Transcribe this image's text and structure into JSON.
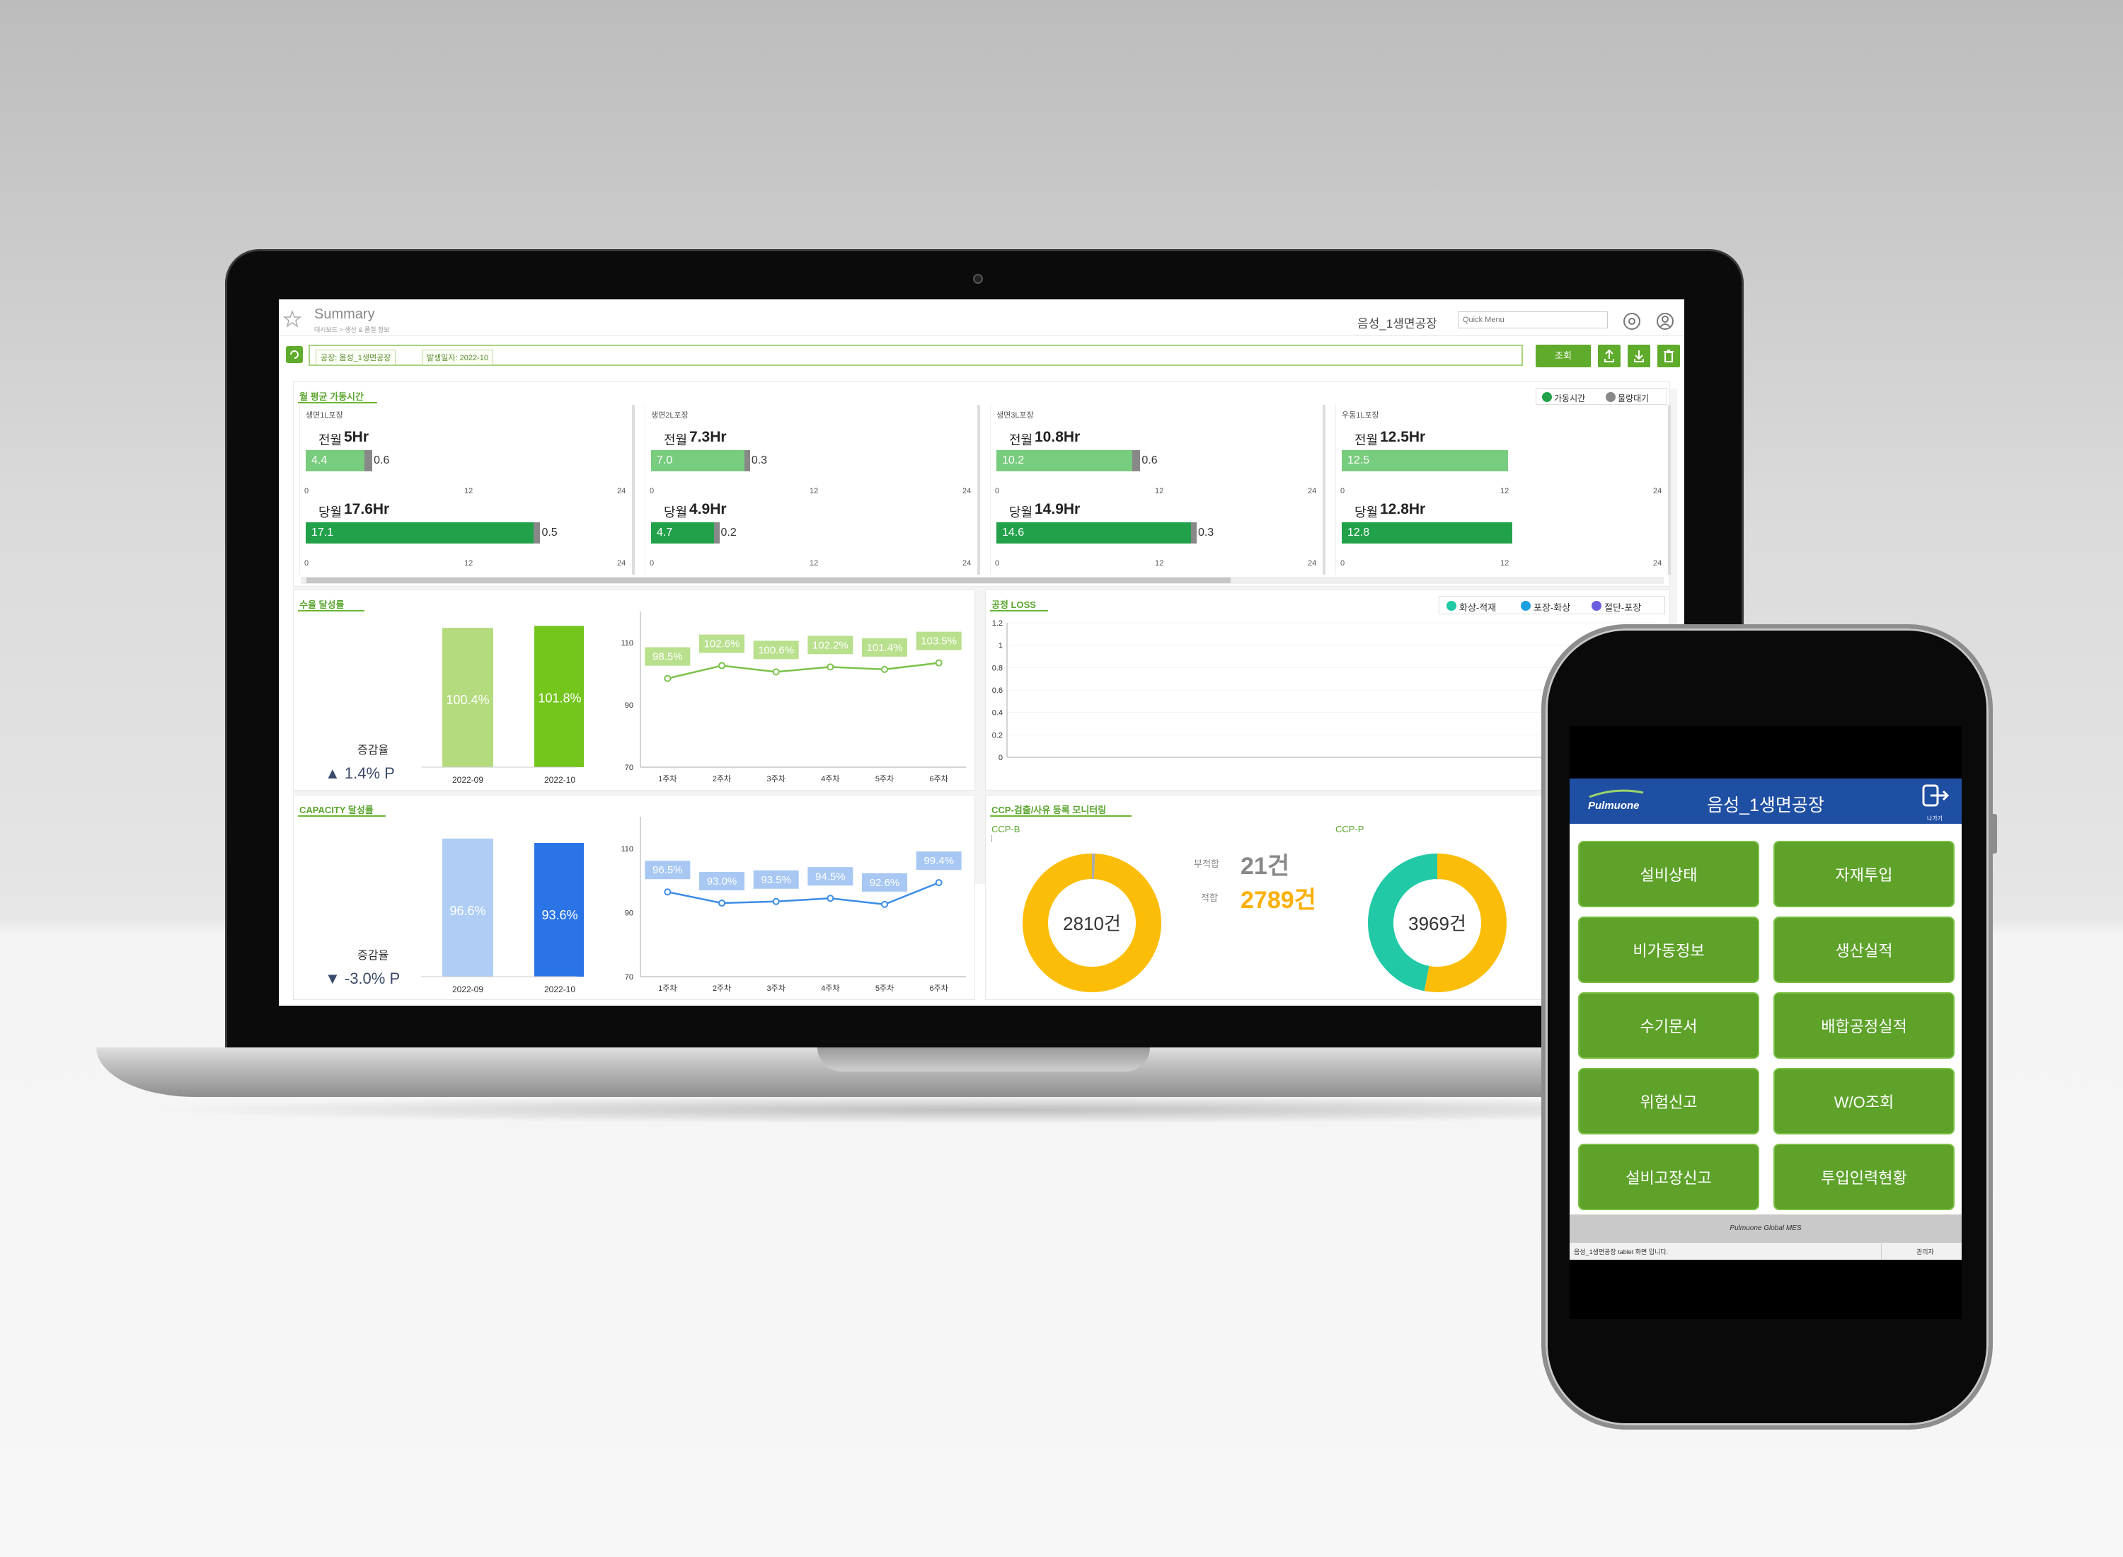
{
  "dashboard": {
    "title": "Summary",
    "breadcrumb": "대시보드 > 생산 & 품질 정보",
    "factory_name": "음성_1생면공장",
    "quick_menu_placeholder": "Quick Menu",
    "filters": {
      "factory_tag": "공장: 음성_1생면공장",
      "date_tag": "발생일자: 2022-10",
      "search_button": "조회"
    },
    "uptime": {
      "title": "월 평균 가동시간",
      "legend": [
        "가동시간",
        "물량대기"
      ],
      "axis": [
        "0",
        "12",
        "24"
      ],
      "prev_label": "전월",
      "curr_label": "당월",
      "lines": [
        {
          "name": "생면1L포장",
          "prev_total": "5Hr",
          "prev_run": 4.4,
          "prev_wait": 0.6,
          "curr_total": "17.6Hr",
          "curr_run": 17.1,
          "curr_wait": 0.5
        },
        {
          "name": "생면2L포장",
          "prev_total": "7.3Hr",
          "prev_run": 7.0,
          "prev_wait": 0.3,
          "curr_total": "4.9Hr",
          "curr_run": 4.7,
          "curr_wait": 0.2
        },
        {
          "name": "생면3L포장",
          "prev_total": "10.8Hr",
          "prev_run": 10.2,
          "prev_wait": 0.6,
          "curr_total": "14.9Hr",
          "curr_run": 14.6,
          "curr_wait": 0.3
        },
        {
          "name": "우동1L포장",
          "prev_total": "12.5Hr",
          "prev_run": 12.5,
          "prev_wait": null,
          "curr_total": "12.8Hr",
          "curr_run": 12.8,
          "curr_wait": null
        }
      ],
      "labels_text": {
        "l1": {
          "pr": "4.4",
          "pw": "0.6",
          "cr": "17.1",
          "cw": "0.5"
        },
        "l2": {
          "pr": "7.0",
          "pw": "0.3",
          "cr": "4.7",
          "cw": "0.2"
        },
        "l3": {
          "pr": "10.2",
          "pw": "0.6",
          "cr": "14.6",
          "cw": "0.3"
        },
        "l4": {
          "pr": "12.5",
          "cr": "12.8"
        }
      }
    },
    "yield_panel": {
      "title": "수율 달성률",
      "change_label": "증감율",
      "change_value": "▲ 1.4% P"
    },
    "capacity_panel": {
      "title": "CAPACITY 달성률",
      "change_label": "증감율",
      "change_value": "▼ -3.0% P"
    },
    "loss_panel": {
      "title": "공정 LOSS",
      "legend": [
        "화상-적재",
        "포장-화상",
        "절단-포장"
      ]
    },
    "ccp_panel": {
      "title": "CCP-검출/사유 등록 모니터링",
      "ccp_b": "CCP-B",
      "ccp_p": "CCP-P",
      "unfit_label": "부적합",
      "unfit_value": "21건",
      "fit_label": "적합",
      "fit_value": "2789건",
      "donut1_center": "2810건",
      "donut2_center": "3969건"
    }
  },
  "chart_data": [
    {
      "type": "bar",
      "title": "수율 달성률",
      "categories": [
        "2022-09",
        "2022-10"
      ],
      "values": [
        100.4,
        101.8
      ],
      "value_labels": [
        "100.4%",
        "101.8%"
      ],
      "colors": [
        "#b5db7f",
        "#74c51c"
      ]
    },
    {
      "type": "line",
      "title": "수율 달성률",
      "x": [
        "1주차",
        "2주차",
        "3주차",
        "4주차",
        "5주차",
        "6주차"
      ],
      "values": [
        98.5,
        102.6,
        100.6,
        102.2,
        101.4,
        103.5
      ],
      "value_labels": [
        "98.5%",
        "102.6%",
        "100.6%",
        "102.2%",
        "101.4%",
        "103.5%"
      ],
      "yticks": [
        "110",
        "90",
        "70"
      ],
      "ylim": [
        70,
        120
      ]
    },
    {
      "type": "bar",
      "title": "CAPACITY 달성률",
      "categories": [
        "2022-09",
        "2022-10"
      ],
      "values": [
        96.6,
        93.6
      ],
      "value_labels": [
        "96.6%",
        "93.6%"
      ],
      "colors": [
        "#afcdf5",
        "#2a74e8"
      ]
    },
    {
      "type": "line",
      "title": "CAPACITY 달성률",
      "x": [
        "1주차",
        "2주차",
        "3주차",
        "4주차",
        "5주차",
        "6주차"
      ],
      "values": [
        96.5,
        93.0,
        93.5,
        94.5,
        92.6,
        99.4
      ],
      "value_labels": [
        "96.5%",
        "93.0%",
        "93.5%",
        "94.5%",
        "92.6%",
        "99.4%"
      ],
      "yticks": [
        "110",
        "90",
        "70"
      ],
      "ylim": [
        70,
        120
      ]
    },
    {
      "type": "line",
      "title": "공정 LOSS",
      "yticks": [
        "1.2",
        "1",
        "0.8",
        "0.6",
        "0.4",
        "0.2",
        "0"
      ],
      "ylim": [
        0,
        1.2
      ],
      "series": []
    },
    {
      "type": "pie",
      "title": "CCP-B",
      "values": [
        21,
        2789
      ],
      "colors": [
        "#aaaaaa",
        "#fbbd07"
      ]
    },
    {
      "type": "pie",
      "title": "CCP-P",
      "values": [
        53,
        47
      ],
      "colors": [
        "#fbbd07",
        "#21c9a6"
      ]
    }
  ],
  "phone": {
    "brand": "Pulmuone",
    "factory_name": "음성_1생면공장",
    "logout_label": "나가기",
    "menu": [
      "설비상태",
      "자재투입",
      "비가동정보",
      "생산실적",
      "수기문서",
      "배합공정실적",
      "위험신고",
      "W/O조회",
      "설비고장신고",
      "투입인력현황"
    ],
    "footer_brand": "Pulmuone Global MES",
    "status_text": "음성_1생면공장 tablet 화면 입니다.",
    "status_right": "관리자"
  },
  "colors": {
    "accent_green": "#5fab2b",
    "phone_header_blue": "#1f4fa3"
  }
}
